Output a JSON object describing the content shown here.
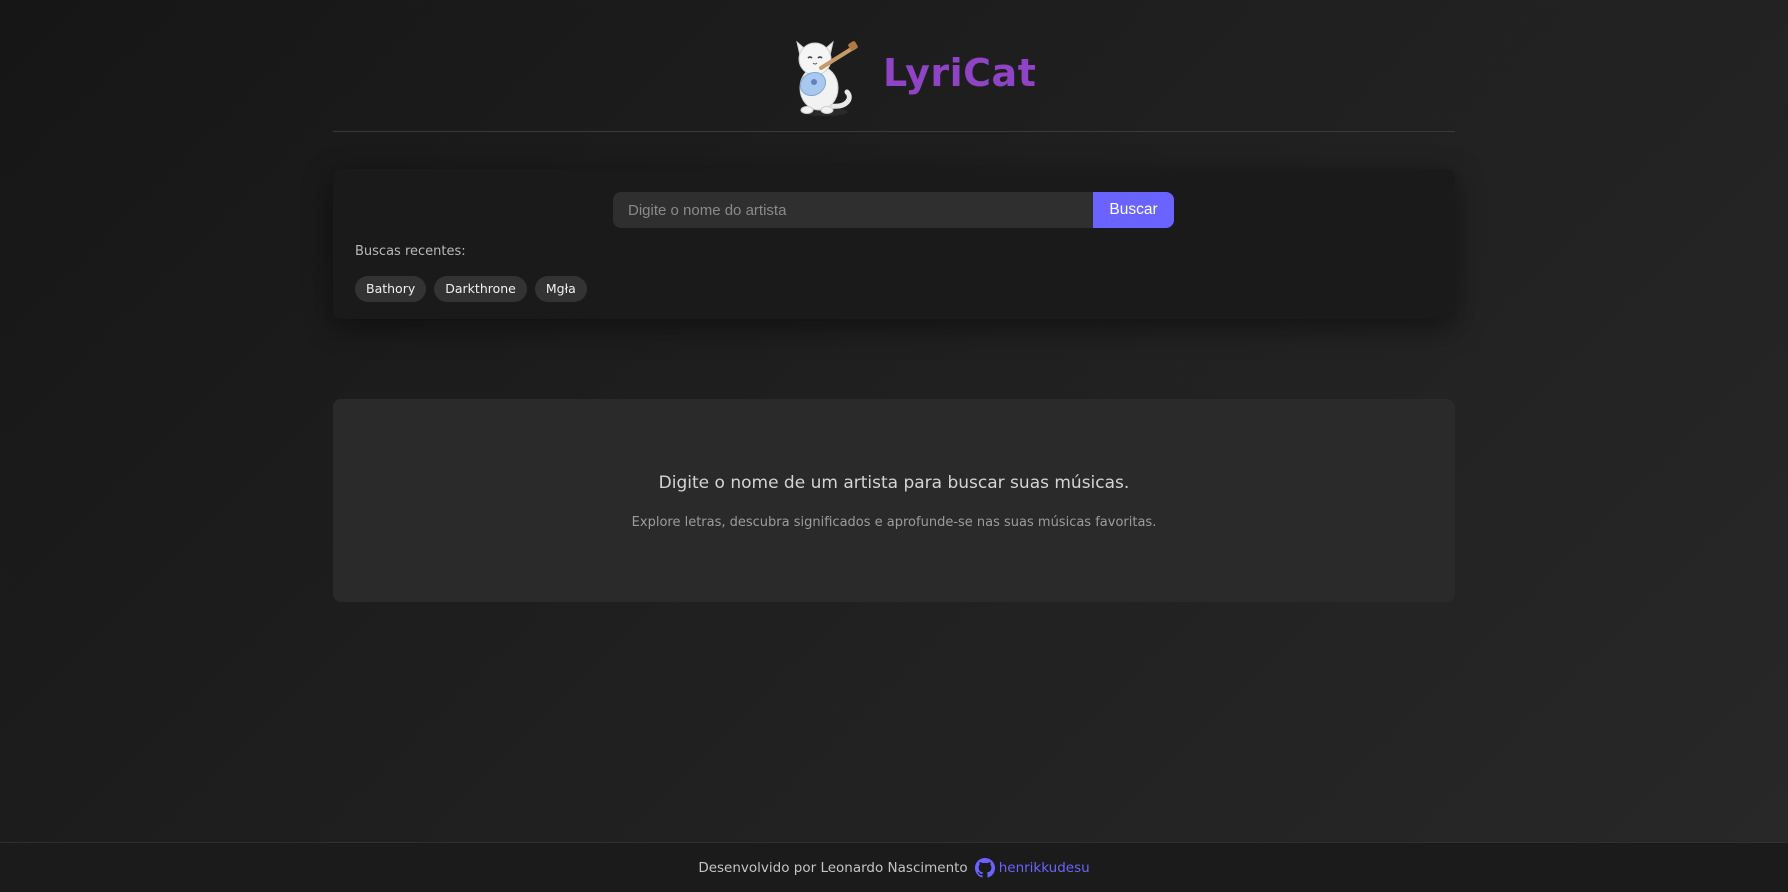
{
  "header": {
    "title": "LyriCat",
    "logo": "cat-with-guitar-logo",
    "title_color": "#8e44c4"
  },
  "search": {
    "placeholder": "Digite o nome do artista",
    "value": "",
    "button_label": "Buscar",
    "accent_color": "#6b63ff"
  },
  "recent": {
    "label": "Buscas recentes:",
    "items": [
      "Bathory",
      "Darkthrone",
      "Mgła"
    ]
  },
  "empty_state": {
    "title": "Digite o nome de um artista para buscar suas músicas.",
    "subtitle": "Explore letras, descubra significados e aprofunde-se nas suas músicas favoritas."
  },
  "footer": {
    "credit": "Desenvolvido por Leonardo Nascimento",
    "github_icon": "github-icon",
    "github_user": "henrikkudesu"
  }
}
